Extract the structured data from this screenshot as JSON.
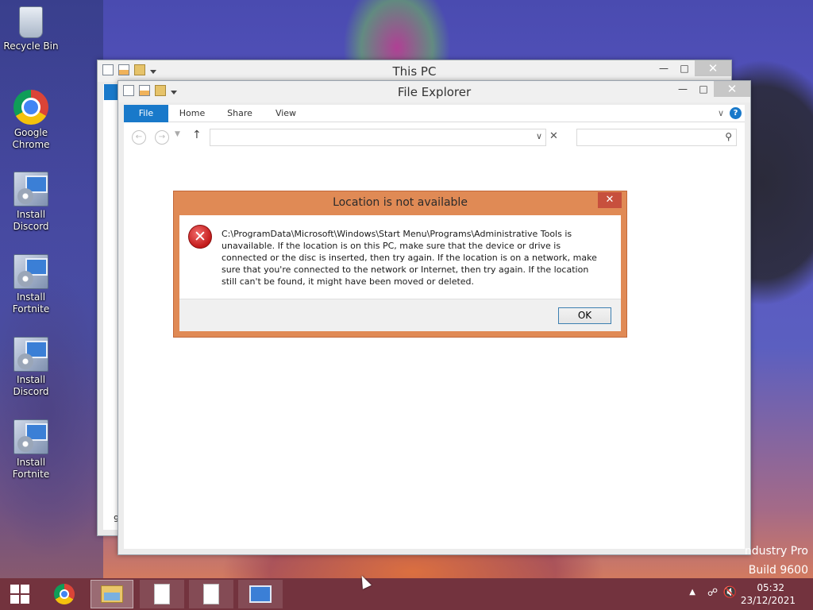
{
  "desktop": {
    "icons": [
      {
        "label": "Recycle Bin",
        "icon": "recycle-bin-icon"
      },
      {
        "label": "Google Chrome",
        "icon": "chrome-icon"
      },
      {
        "label": "Install Discord",
        "icon": "setup-icon"
      },
      {
        "label": "Install Fortnite",
        "icon": "setup-icon"
      },
      {
        "label": "Install Discord",
        "icon": "setup-icon"
      },
      {
        "label": "Install Fortnite",
        "icon": "setup-icon"
      }
    ],
    "watermark_line1": "ndustry Pro",
    "watermark_line2": "Build 9600"
  },
  "back_window": {
    "title": "This PC",
    "partial_text": "9"
  },
  "front_window": {
    "title": "File Explorer",
    "ribbon_tabs": [
      "File",
      "Home",
      "Share",
      "View"
    ],
    "address_value": "",
    "search_value": "",
    "help_label": "?"
  },
  "dialog": {
    "title": "Location is not available",
    "message": "C:\\ProgramData\\Microsoft\\Windows\\Start Menu\\Programs\\Administrative Tools is unavailable. If the location is on this PC, make sure that the device or drive is connected or the disc is inserted, then try again. If the location is on a network, make sure that you're connected to the network or Internet, then try again. If the location still can't be found, it might have been moved or deleted.",
    "ok_label": "OK",
    "close_label": "✕"
  },
  "taskbar": {
    "clock_time": "05:32",
    "clock_date": "23/12/2021"
  },
  "colors": {
    "dialog_border": "#e08a55",
    "file_tab": "#1979ca",
    "taskbar": "#78323a"
  }
}
